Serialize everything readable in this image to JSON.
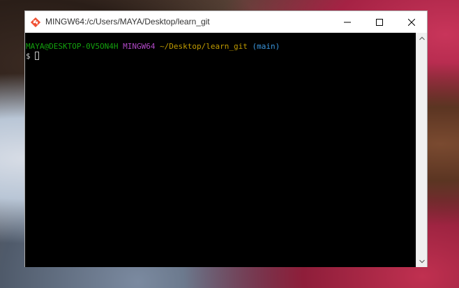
{
  "window": {
    "title": "MINGW64:/c/Users/MAYA/Desktop/learn_git",
    "app_icon": "git-logo-icon",
    "controls": [
      "minimize-icon",
      "maximize-icon",
      "close-icon"
    ]
  },
  "terminal": {
    "prompt": {
      "user_host": "MAYA@DESKTOP-0V5ON4H",
      "env": "MINGW64",
      "path": "~/Desktop/learn_git",
      "branch": "(main)",
      "symbol": "$"
    },
    "colors": {
      "user_host": "#13a10e",
      "env": "#b148c6",
      "path": "#c19c00",
      "branch": "#3a96dd",
      "symbol": "#cccccc",
      "background": "#000000"
    }
  }
}
